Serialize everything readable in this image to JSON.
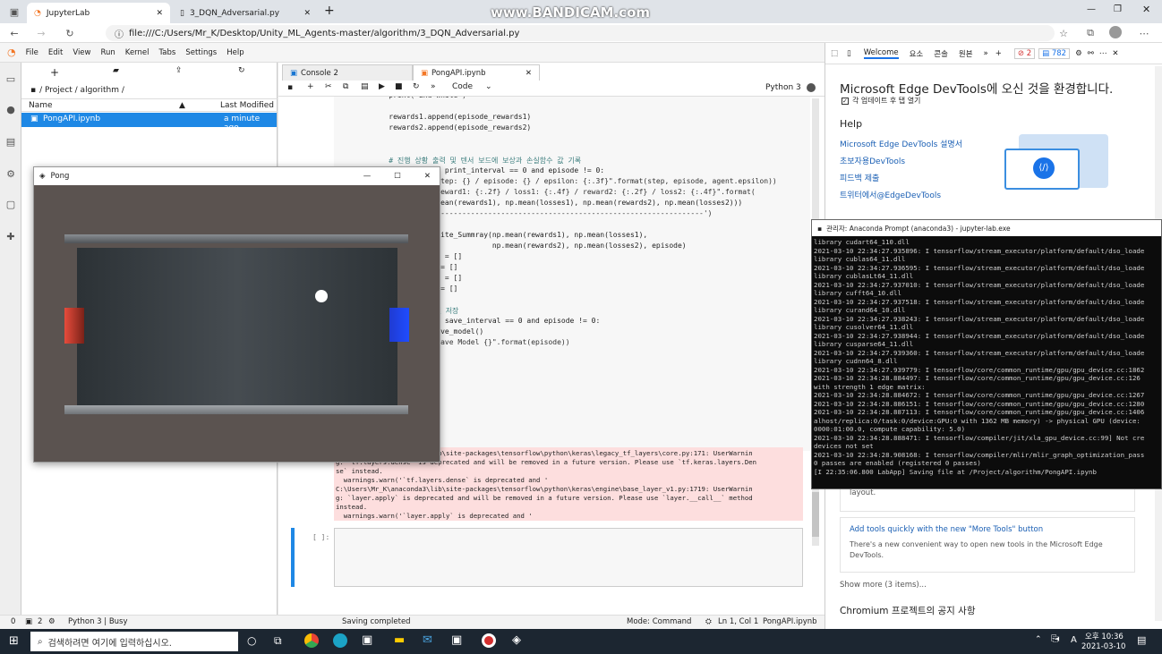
{
  "browser": {
    "tabs": [
      {
        "title": "JupyterLab"
      },
      {
        "title": "3_DQN_Adversarial.py"
      }
    ],
    "address": "file:///C:/Users/Mr_K/Desktop/Unity_ML_Agents-master/algorithm/3_DQN_Adversarial.py",
    "watermark": "www.BANDICAM.com"
  },
  "jupyter": {
    "menu": [
      "File",
      "Edit",
      "View",
      "Run",
      "Kernel",
      "Tabs",
      "Settings",
      "Help"
    ],
    "filebrowser": {
      "path": "/ Project / algorithm /",
      "col_name": "Name",
      "col_modified": "Last Modified",
      "files": [
        {
          "name": "PongAPI.ipynb",
          "modified": "a minute ago"
        }
      ]
    },
    "tabs": [
      {
        "label": "Console 2"
      },
      {
        "label": "PongAPI.ipynb"
      }
    ],
    "toolbar": {
      "celltype": "Code",
      "kernel": "Python 3"
    },
    "code": [
      "    print(\"End While\")",
      "",
      "    rewards1.append(episode_rewards1)",
      "    rewards2.append(episode_rewards2)",
      "",
      "",
      "    # 진행 상황 출력 및 텐서 보드에 보상과 손실함수 값 기록",
      "    if episode % print_interval == 0 and episode != 0:",
      "        print(\"step: {} / episode: {} / epsilon: {:.3f}\".format(step, episode, agent.epsilon))",
      "        print(\"reward1: {:.2f} / loss1: {:.4f} / reward2: {:.2f} / loss2: {:.4f}\".format(",
      "            np.mean(rewards1), np.mean(losses1), np.mean(rewards2), np.mean(losses2)))",
      "        print('--------------------------------------------------------------')",
      "",
      "        agent.Write_Summray(np.mean(rewards1), np.mean(losses1),",
      "                            np.mean(rewards2), np.mean(losses2), episode)",
      "        rewards1 = []",
      "        losses1 = []",
      "        rewards2 = []",
      "        losses2 = []",
      "",
      "    # 네트워크 모델 저장",
      "    if episode % save_interval == 0 and episode != 0:",
      "        agent.save_model()",
      "        print(\"Save Model {}\".format(episode))"
    ],
    "warnings": [
      "C:\\Users\\Mr_K\\anaconda3\\lib\\site-packages\\tensorflow\\python\\keras\\legacy_tf_layers\\core.py:171: UserWarnin",
      "g: `tf.layers.dense` is deprecated and will be removed in a future version. Please use `tf.keras.layers.Den",
      "se` instead.",
      "  warnings.warn('`tf.layers.dense` is deprecated and '",
      "C:\\Users\\Mr_K\\anaconda3\\lib\\site-packages\\tensorflow\\python\\keras\\engine\\base_layer_v1.py:1719: UserWarnin",
      "g: `layer.apply` is deprecated and will be removed in a future version. Please use `layer.__call__` method",
      "instead.",
      "  warnings.warn('`layer.apply` is deprecated and '"
    ],
    "empty_prompt": "[ ]:",
    "status": {
      "left1": "0",
      "left2": "2",
      "kernel": "Python 3 | Busy",
      "msg": "Saving completed",
      "mode": "Mode: Command",
      "pos": "Ln 1, Col 1",
      "file": "PongAPI.ipynb"
    }
  },
  "pong": {
    "title": "Pong"
  },
  "devtools": {
    "tabs": [
      "Welcome",
      "요소",
      "콘솔",
      "원본"
    ],
    "errors": "2",
    "messages": "782",
    "heading": "Microsoft Edge DevTools에 오신 것을 환경합니다.",
    "checkbox": "각 업데이트 후 탭 열기",
    "help_title": "Help",
    "links": [
      "Microsoft Edge DevTools 설명서",
      "초보자용DevTools",
      "피드백 제출",
      "트위터에서@EdgeDevTools"
    ],
    "card1": "layout.",
    "card2_title": "Add tools quickly with the new \"More Tools\" button",
    "card2_body": "There's a new convenient way to open new tools in the Microsoft Edge DevTools.",
    "show_more": "Show more (3 items)...",
    "chromium": "Chromium 프로젝트의 공지 사항"
  },
  "prompt": {
    "title": "관리자: Anaconda Prompt (anaconda3) - jupyter-lab.exe",
    "lines": [
      "library cudart64_110.dll",
      "2021-03-10 22:34:27.935896: I tensorflow/stream_executor/platform/default/dso_loade",
      "library cublas64_11.dll",
      "2021-03-10 22:34:27.936595: I tensorflow/stream_executor/platform/default/dso_loade",
      "library cublasLt64_11.dll",
      "2021-03-10 22:34:27.937010: I tensorflow/stream_executor/platform/default/dso_loade",
      "library cufft64_10.dll",
      "2021-03-10 22:34:27.937518: I tensorflow/stream_executor/platform/default/dso_loade",
      "library curand64_10.dll",
      "2021-03-10 22:34:27.938243: I tensorflow/stream_executor/platform/default/dso_loade",
      "library cusolver64_11.dll",
      "2021-03-10 22:34:27.938944: I tensorflow/stream_executor/platform/default/dso_loade",
      "library cusparse64_11.dll",
      "2021-03-10 22:34:27.939360: I tensorflow/stream_executor/platform/default/dso_loade",
      "library cudnn64_8.dll",
      "2021-03-10 22:34:27.939779: I tensorflow/core/common_runtime/gpu/gpu_device.cc:1862",
      "2021-03-10 22:34:28.884497: I tensorflow/core/common_runtime/gpu/gpu_device.cc:126",
      "with strength 1 edge matrix:",
      "2021-03-10 22:34:28.884672: I tensorflow/core/common_runtime/gpu/gpu_device.cc:1267",
      "2021-03-10 22:34:28.886151: I tensorflow/core/common_runtime/gpu/gpu_device.cc:1280",
      "2021-03-10 22:34:28.887113: I tensorflow/core/common_runtime/gpu/gpu_device.cc:1406",
      "alhost/replica:0/task:0/device:GPU:0 with 1362 MB memory) -> physical GPU (device:",
      "0000:01:00.0, compute capability: 5.0)",
      "2021-03-10 22:34:28.888471: I tensorflow/compiler/jit/xla_gpu_device.cc:99] Not cre",
      "devices not set",
      "2021-03-10 22:34:28.908168: I tensorflow/compiler/mlir/mlir_graph_optimization_pass",
      "0 passes are enabled (registered 0 passes)",
      "[I 22:35:06.800 LabApp] Saving file at /Project/algorithm/PongAPI.ipynb"
    ]
  },
  "taskbar": {
    "search": "검색하려면 여기에 입력하십시오.",
    "ampm": "오후 10:36",
    "date": "2021-03-10",
    "lang": "A"
  }
}
